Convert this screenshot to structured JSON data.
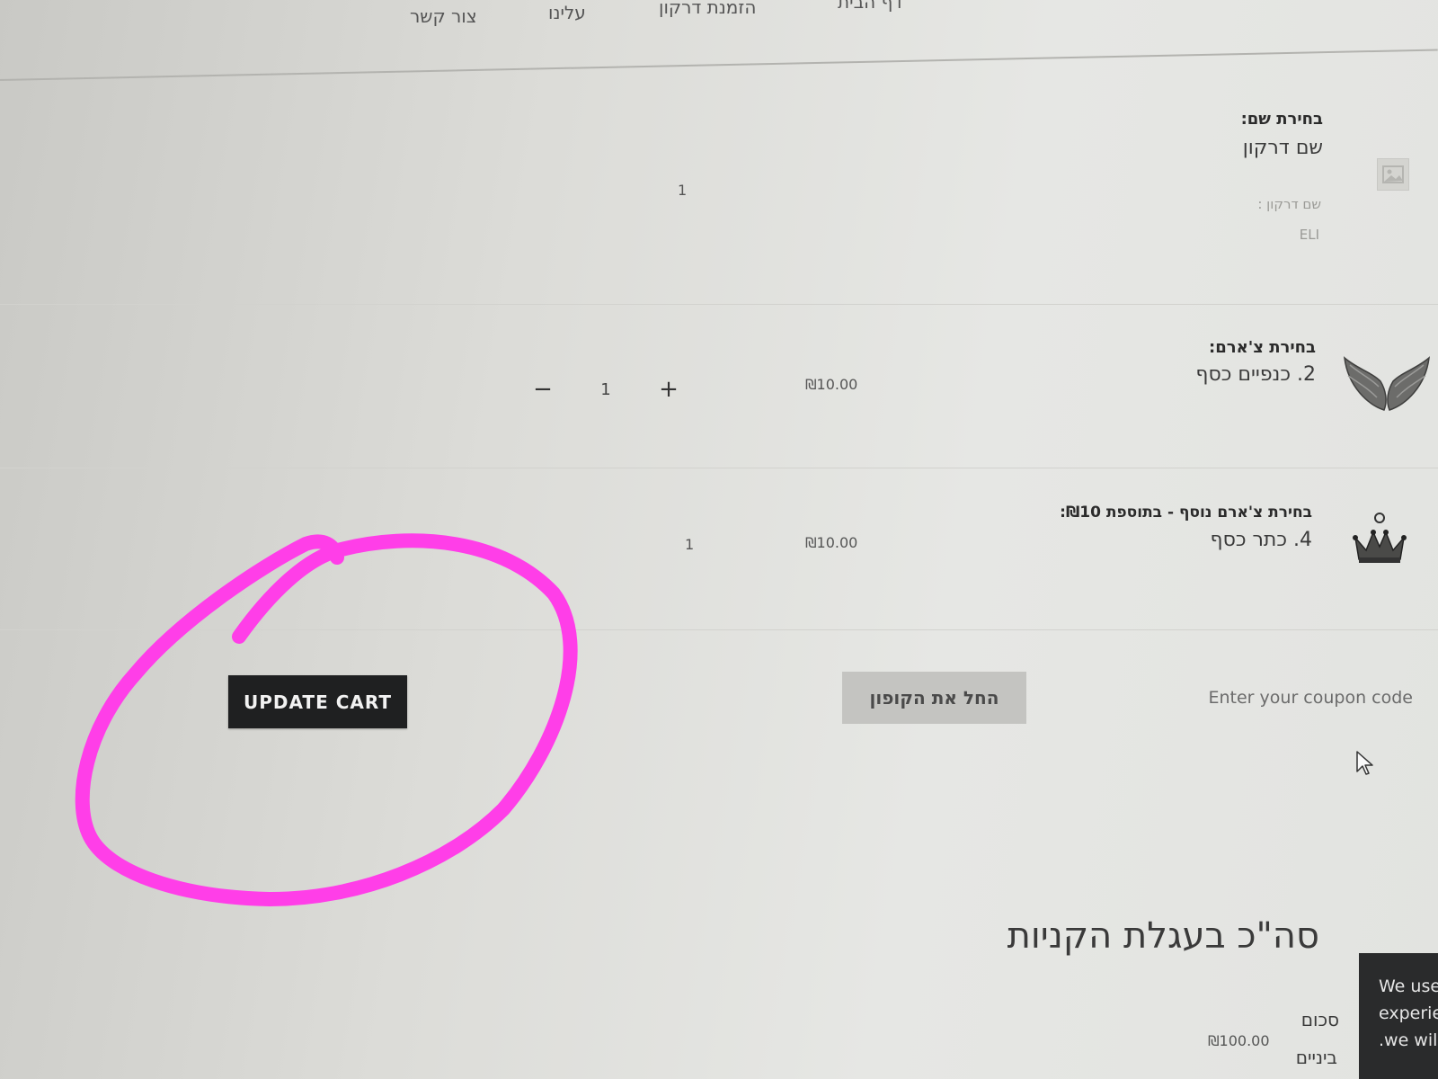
{
  "nav": {
    "items": [
      "צור קשר",
      "עלינו",
      "הזמנת דרקון",
      "דף הבית"
    ]
  },
  "cart": {
    "items": [
      {
        "label": "בחירת שם:",
        "value": "שם דרקון",
        "meta_label": "שם דרקון :",
        "meta_value": "ELI",
        "quantity": "1",
        "image": "image-placeholder-icon"
      },
      {
        "label": "בחירת צ'ארם:",
        "value": "2. כנפיים כסף",
        "price": "₪10.00",
        "quantity": "1",
        "decrement": "−",
        "increment": "+",
        "image": "silver-wings-icon"
      },
      {
        "label": "בחירת צ'ארם נוסף - בתוספת ₪10:",
        "value": "4. כתר כסף",
        "price": "₪10.00",
        "quantity": "1",
        "image": "silver-crown-icon"
      }
    ],
    "actions": {
      "update_label": "UPDATE CART",
      "coupon_placeholder": "Enter your coupon code",
      "coupon_button_label": "החל את הקופון"
    }
  },
  "totals": {
    "title": "סה\"כ בעגלת הקניות",
    "subtotal_label": "סכום",
    "subtotal_value": "₪100.00",
    "shipping_label": "ביניים"
  },
  "cookie_notice": {
    "lines": [
      "We use",
      "experie",
      ".we will"
    ]
  },
  "colors": {
    "annotation": "#ff3ee8",
    "button_dark": "#1f2021",
    "button_gray": "#c4c4c1"
  }
}
